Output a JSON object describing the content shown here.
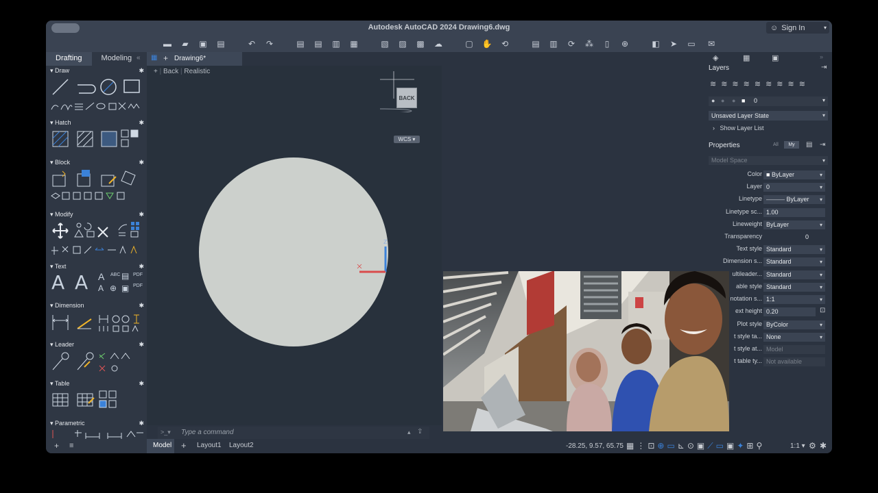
{
  "window": {
    "title": "Autodesk AutoCAD 2024   Drawing6.dwg",
    "signin": "Sign In"
  },
  "left_tabs": [
    "Drafting",
    "Modeling"
  ],
  "palette": {
    "sections": [
      "Draw",
      "Hatch",
      "Block",
      "Modify",
      "Text",
      "Dimension",
      "Leader",
      "Table",
      "Parametric"
    ]
  },
  "doc_tab": "Drawing6*",
  "viewport": {
    "back": "Back",
    "style": "Realistic",
    "viewcube_face": "BACK",
    "wcs": "WCS"
  },
  "command_placeholder": "Type a command",
  "layout_tabs": [
    "Model",
    "Layout1",
    "Layout2"
  ],
  "coordinates": "-28.25, 9.57, 65.75",
  "layers": {
    "title": "Layers",
    "current_layer": "0",
    "layer_state": "Unsaved Layer State",
    "show_list": "Show Layer List"
  },
  "properties": {
    "title": "Properties",
    "filters": [
      "All",
      "My"
    ],
    "space": "Model Space",
    "rows": [
      {
        "label": "Color",
        "value": "ByLayer"
      },
      {
        "label": "Layer",
        "value": "0"
      },
      {
        "label": "Linetype",
        "value": "ByLayer"
      },
      {
        "label": "Linetype sc...",
        "value": "1.00"
      },
      {
        "label": "Lineweight",
        "value": "ByLayer"
      },
      {
        "label": "Transparency",
        "value": "0"
      },
      {
        "label": "Text style",
        "value": "Standard"
      },
      {
        "label": "Dimension s...",
        "value": "Standard"
      },
      {
        "label": "ultileader...",
        "value": "Standard"
      },
      {
        "label": "able style",
        "value": "Standard"
      },
      {
        "label": "notation s...",
        "value": "1:1"
      },
      {
        "label": "ext height",
        "value": "0.20"
      },
      {
        "label": "Plot style",
        "value": "ByColor"
      },
      {
        "label": "t style ta...",
        "value": "None"
      },
      {
        "label": "t style at...",
        "value": "Model"
      },
      {
        "label": "t table ty...",
        "value": "Not available"
      }
    ]
  },
  "colors": {
    "window_bg": "#2b3340",
    "panel_bg": "#2f3744",
    "accent": "#3b82d9",
    "circle": "#ccd0cc"
  }
}
